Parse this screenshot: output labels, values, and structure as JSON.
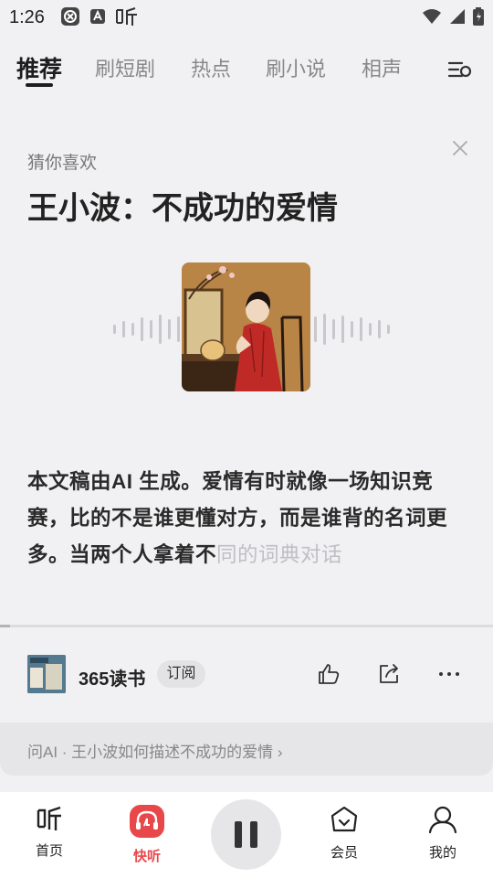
{
  "status": {
    "time": "1:26",
    "left_icons": [
      "app-badge-icon",
      "a-notification-icon",
      "ting-icon"
    ],
    "right_icons": [
      "wifi-icon",
      "signal-icon",
      "battery-icon"
    ]
  },
  "tabs": [
    {
      "label": "推荐",
      "active": true
    },
    {
      "label": "刷短剧",
      "active": false
    },
    {
      "label": "热点",
      "active": false
    },
    {
      "label": "刷小说",
      "active": false
    },
    {
      "label": "相声",
      "active": false
    }
  ],
  "recommendation": {
    "label": "猜你喜欢",
    "title": "王小波：不成功的爱情"
  },
  "body": {
    "text_main": "本文稿由AI 生成。爱情有时就像一场知识竞赛，比的不是谁更懂对方，而是谁背的名词更多。当两个人拿着不",
    "text_faded": "同的词典对话"
  },
  "progress": 0.02,
  "source": {
    "name": "365读书",
    "subscribe_label": "订阅"
  },
  "ask_ai": {
    "text": "问AI · 王小波如何描述不成功的爱情",
    "chevron": "›"
  },
  "bottom_nav": [
    {
      "label": "首页",
      "icon": "ting-logo-icon",
      "active": false
    },
    {
      "label": "快听",
      "icon": "headphones-icon",
      "active": true
    },
    {
      "label": "会员",
      "icon": "crown-basket-icon",
      "active": false
    },
    {
      "label": "我的",
      "icon": "person-icon",
      "active": false
    }
  ],
  "colors": {
    "accent": "#e8484a",
    "background": "#f1f1f3"
  }
}
